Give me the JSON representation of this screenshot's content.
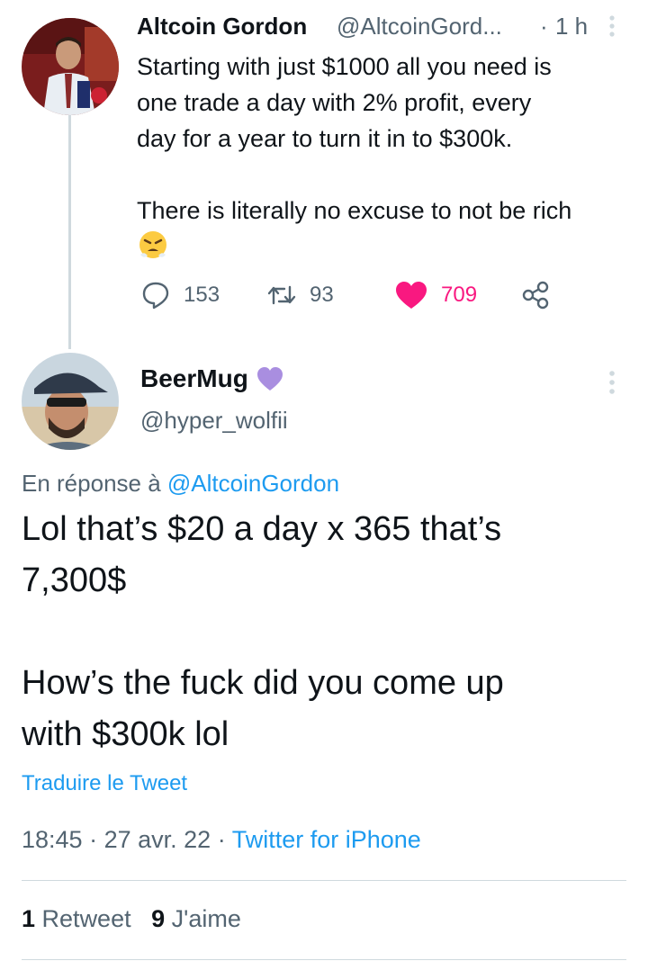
{
  "parent_tweet": {
    "author_name": "Altcoin Gordon",
    "author_handle": "@AltcoinGord...",
    "separator": "·",
    "time": "1 h",
    "text": "Starting with just $1000 all you need is\none trade a day with 2% profit, every\nday for a year to turn it in to $300k.\n\nThere is literally no excuse to not be rich",
    "emoji": "triumph-face",
    "actions": {
      "replies": "153",
      "retweets": "93",
      "likes": "709"
    },
    "colors": {
      "like": "#f91880"
    }
  },
  "reply_tweet": {
    "author_name": "BeerMug",
    "author_badge": "purple-heart",
    "author_handle": "@hyper_wolfii",
    "replying_prefix": "En réponse à",
    "replying_to": "@AltcoinGordon",
    "text": "Lol that’s $20 a day x 365 that’s\n7,300$\n\nHow’s the fuck did you come up\nwith $300k lol",
    "translate_label": "Traduire le Tweet",
    "time": "18:45",
    "date": "27 avr. 22",
    "meta_separator": "·",
    "source": "Twitter for iPhone",
    "retweet_count": "1",
    "retweet_label": "Retweet",
    "like_count": "9",
    "like_label": "J'aime"
  },
  "colors": {
    "link": "#1d9bf0",
    "secondary_text": "#536471",
    "badge": "#a98ee0",
    "divider": "#cfd9de"
  }
}
